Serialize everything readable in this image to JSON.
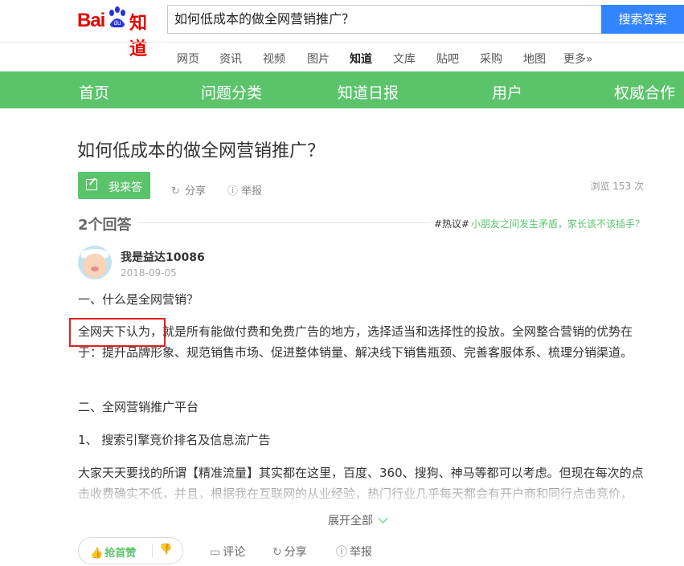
{
  "header": {
    "logo_bai": "Bai",
    "logo_du": "du",
    "logo_zhidao": "知道",
    "search_value": "如何低成本的做全网营销推广？",
    "search_button": "搜索答案"
  },
  "topnav": [
    "网页",
    "资讯",
    "视频",
    "图片",
    "知道",
    "文库",
    "贴吧",
    "采购",
    "地图",
    "更多»"
  ],
  "greennav": [
    "首页",
    "问题分类",
    "知道日报",
    "用户",
    "权威合作"
  ],
  "question": {
    "title": "如何低成本的做全网营销推广？",
    "answer_button": "我来答",
    "share": "分享",
    "report": "举报",
    "views": "浏览 153 次"
  },
  "answers": {
    "count_label": "2个回答",
    "hot_tag": "#热议#",
    "hot_text": "小朋友之间发生矛盾，家长该不该插手？"
  },
  "answer": {
    "username": "我是益达10086",
    "date": "2018-09-05",
    "p1": "一、什么是全网营销？",
    "p2": "全网天下认为，就是所有能做付费和免费广告的地方，选择适当和选择性的投放。全网整合营销的优势在于：提升品牌形象、规范销售市场、促进整体销量、解决线下销售瓶颈、完善客服体系、梳理分销渠道。",
    "p3": "二、全网营销推广平台",
    "p4": "1、 搜索引擎竞价排名及信息流广告",
    "p5": "大家天天要找的所谓【精准流量】其实都在这里，百度、360、搜狗、神马等都可以考虑。但现在每次的点击收费确实不低，并且，根据我在互联网的从业经验，热门行业几乎每天都会有开户商和同行点击竞价，"
  },
  "footer": {
    "expand": "展开全部",
    "like": "抢首赞",
    "comment": "评论",
    "share": "分享",
    "report": "举报"
  },
  "colors": {
    "green": "#5bc46b",
    "blue": "#3385ff",
    "red": "#e10602"
  }
}
